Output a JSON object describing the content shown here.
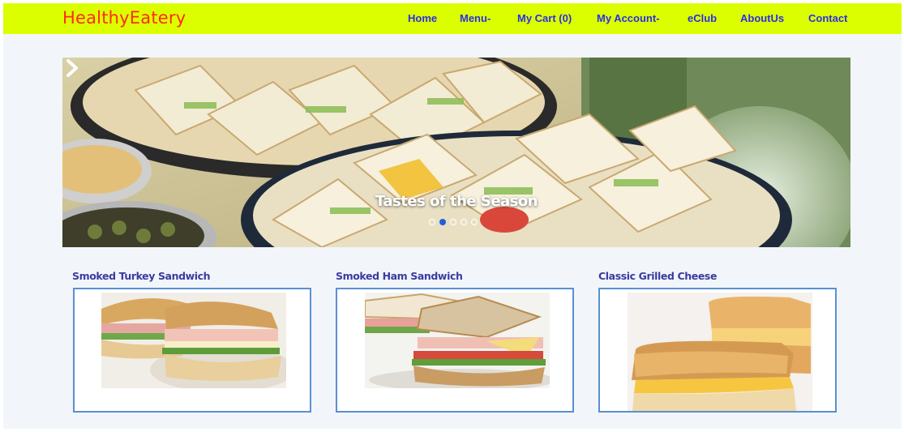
{
  "brand": "HealthyEatery",
  "nav": {
    "home": "Home",
    "menu": "Menu-",
    "cart": "My Cart (0)",
    "account": "My Account-",
    "eclub": "eClub",
    "about": "AboutUs",
    "contact": "Contact"
  },
  "carousel": {
    "caption": "Tastes of the Season",
    "slide_count": 5,
    "active_slide": 2,
    "next_icon": "chevron-right-icon"
  },
  "products": [
    {
      "title": "Smoked Turkey Sandwich"
    },
    {
      "title": "Smoked Ham Sandwich"
    },
    {
      "title": "Classic Grilled Cheese"
    }
  ],
  "colors": {
    "navbar_bg": "#dcff00",
    "brand": "#ff2a1a",
    "nav_link": "#2a2ee8",
    "card_border": "#5b8fd1",
    "card_title": "#3b3ba0",
    "active_dot": "#1f5fd6"
  }
}
